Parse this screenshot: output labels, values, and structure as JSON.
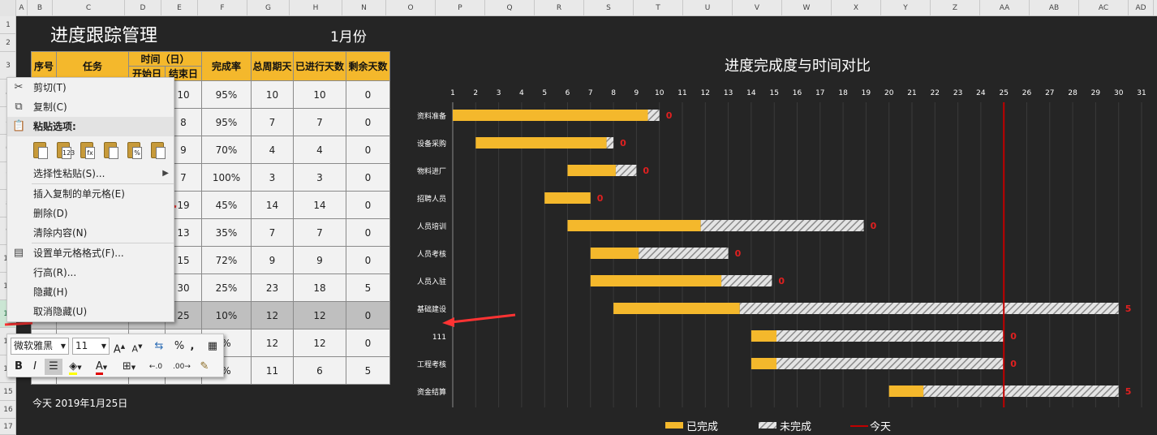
{
  "columns": [
    "A",
    "B",
    "C",
    "D",
    "E",
    "F",
    "G",
    "H",
    "N",
    "O",
    "P",
    "Q",
    "R",
    "S",
    "T",
    "U",
    "V",
    "W",
    "X",
    "Y",
    "Z",
    "AA",
    "AB",
    "AC",
    "AD"
  ],
  "rows": [
    "1",
    "2",
    "3",
    "4",
    "5",
    "6",
    "7",
    "8",
    "9",
    "10",
    "11",
    "12",
    "13",
    "14",
    "15",
    "16",
    "17"
  ],
  "sheet": {
    "title": "进度跟踪管理",
    "month": "1月份",
    "today_label": "今天 2019年1月25日"
  },
  "table": {
    "headers": {
      "seq": "序号",
      "task": "任务",
      "time": "时间（日）",
      "start": "开始日",
      "end": "结束日",
      "rate": "完成率",
      "total": "总周期天",
      "done": "已进行天数",
      "remain": "剩余天数"
    },
    "rows": [
      {
        "end": "10",
        "rate": "95%",
        "total": "10",
        "done": "10",
        "remain": "0"
      },
      {
        "end": "8",
        "rate": "95%",
        "total": "7",
        "done": "7",
        "remain": "0"
      },
      {
        "end": "9",
        "rate": "70%",
        "total": "4",
        "done": "4",
        "remain": "0"
      },
      {
        "end": "7",
        "rate": "100%",
        "total": "3",
        "done": "3",
        "remain": "0"
      },
      {
        "end": "19",
        "rate": "45%",
        "total": "14",
        "done": "14",
        "remain": "0"
      },
      {
        "end": "13",
        "rate": "35%",
        "total": "7",
        "done": "7",
        "remain": "0"
      },
      {
        "end": "15",
        "rate": "72%",
        "total": "9",
        "done": "9",
        "remain": "0"
      },
      {
        "end": "30",
        "rate": "25%",
        "total": "23",
        "done": "18",
        "remain": "5"
      },
      {
        "end": "25",
        "rate": "10%",
        "total": "12",
        "done": "12",
        "remain": "0"
      },
      {
        "end": "",
        "rate": "%",
        "total": "12",
        "done": "12",
        "remain": "0"
      },
      {
        "end": "",
        "rate": "%",
        "total": "11",
        "done": "6",
        "remain": "5"
      }
    ]
  },
  "context_menu": {
    "cut": "剪切(T)",
    "copy": "复制(C)",
    "paste_options": "粘贴选项:",
    "paste_icon_labels": [
      "",
      "123",
      "fx",
      "",
      "%",
      ""
    ],
    "paste_special": "选择性粘贴(S)...",
    "insert_copied": "插入复制的单元格(E)",
    "delete": "删除(D)",
    "clear": "清除内容(N)",
    "format_cells": "设置单元格格式(F)...",
    "row_height": "行高(R)...",
    "hide": "隐藏(H)",
    "unhide": "取消隐藏(U)"
  },
  "mini_toolbar": {
    "font": "微软雅黑",
    "size": "11",
    "grow": "A",
    "shrink": "A",
    "percent": "%",
    "comma": ",",
    "bold": "B",
    "italic": "I",
    "font_color": "A",
    "inc_decimal": "←.0",
    "dec_decimal": ".00→"
  },
  "chart_data": {
    "type": "bar",
    "title": "进度完成度与时间对比",
    "x_ticks": [
      "1",
      "2",
      "3",
      "4",
      "5",
      "6",
      "7",
      "8",
      "9",
      "10",
      "11",
      "12",
      "13",
      "14",
      "15",
      "16",
      "17",
      "18",
      "19",
      "20",
      "21",
      "22",
      "23",
      "24",
      "25",
      "26",
      "27",
      "28",
      "29",
      "30",
      "31"
    ],
    "xlim": [
      1,
      32
    ],
    "today": 25,
    "today_label": "今天",
    "legend": [
      "已完成",
      "未完成",
      "今天"
    ],
    "legend_position": "bottom",
    "colors": {
      "done": "#f4b82c",
      "todo": "#b8b8b8",
      "today": "#c00000",
      "label": "#e02020"
    },
    "tasks": [
      {
        "name": "资料准备",
        "start": 1,
        "done": 8.5,
        "todo": 0.5,
        "remain_label": "0"
      },
      {
        "name": "设备采购",
        "start": 2,
        "done": 5.7,
        "todo": 0.3,
        "remain_label": "0"
      },
      {
        "name": "物料进厂",
        "start": 6,
        "done": 2.1,
        "todo": 0.9,
        "remain_label": "0"
      },
      {
        "name": "招聘人员",
        "start": 5,
        "done": 2,
        "todo": 0,
        "remain_label": "0"
      },
      {
        "name": "人员培训",
        "start": 6,
        "done": 5.8,
        "todo": 7.1,
        "remain_label": "0"
      },
      {
        "name": "人员考核",
        "start": 7,
        "done": 2.1,
        "todo": 3.9,
        "remain_label": "0"
      },
      {
        "name": "人员入驻",
        "start": 7,
        "done": 5.7,
        "todo": 2.2,
        "remain_label": "0"
      },
      {
        "name": "基础建设",
        "start": 8,
        "done": 5.5,
        "todo": 16.5,
        "remain_label": "5"
      },
      {
        "name": "111",
        "start": 14,
        "done": 1.1,
        "todo": 9.9,
        "remain_label": "0"
      },
      {
        "name": "工程考核",
        "start": 14,
        "done": 1.1,
        "todo": 9.9,
        "remain_label": "0"
      },
      {
        "name": "资金结算",
        "start": 20,
        "done": 1.5,
        "todo": 8.5,
        "remain_label": "5"
      }
    ]
  }
}
